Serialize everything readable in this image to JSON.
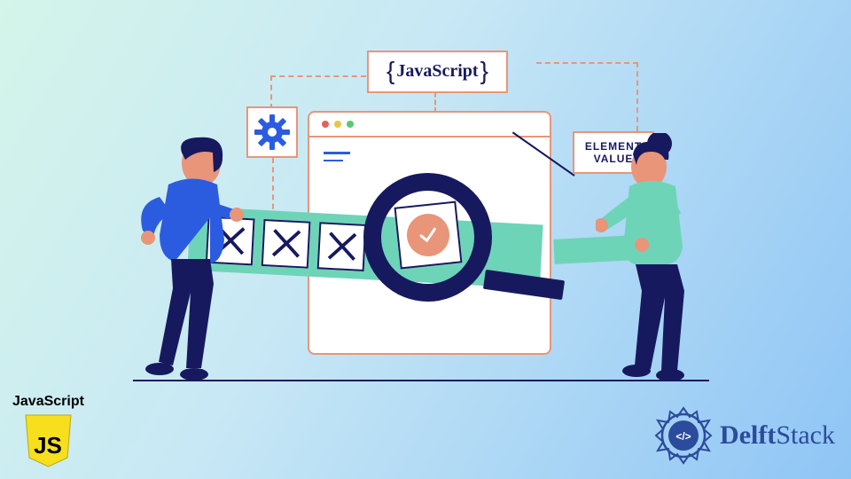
{
  "js_badge": {
    "open": "{",
    "text": "JavaScript",
    "close": "}"
  },
  "element_label": {
    "line1": "ELEMENT",
    "line2": "VALUE"
  },
  "js_corner": {
    "label": "JavaScript",
    "shield_text": "JS"
  },
  "delft": {
    "prefix": "Delft",
    "suffix": "Stack"
  },
  "colors": {
    "navy": "#17195f",
    "salmon": "#e8957a",
    "mint": "#6ed4b8",
    "blue": "#2b5ce0"
  }
}
